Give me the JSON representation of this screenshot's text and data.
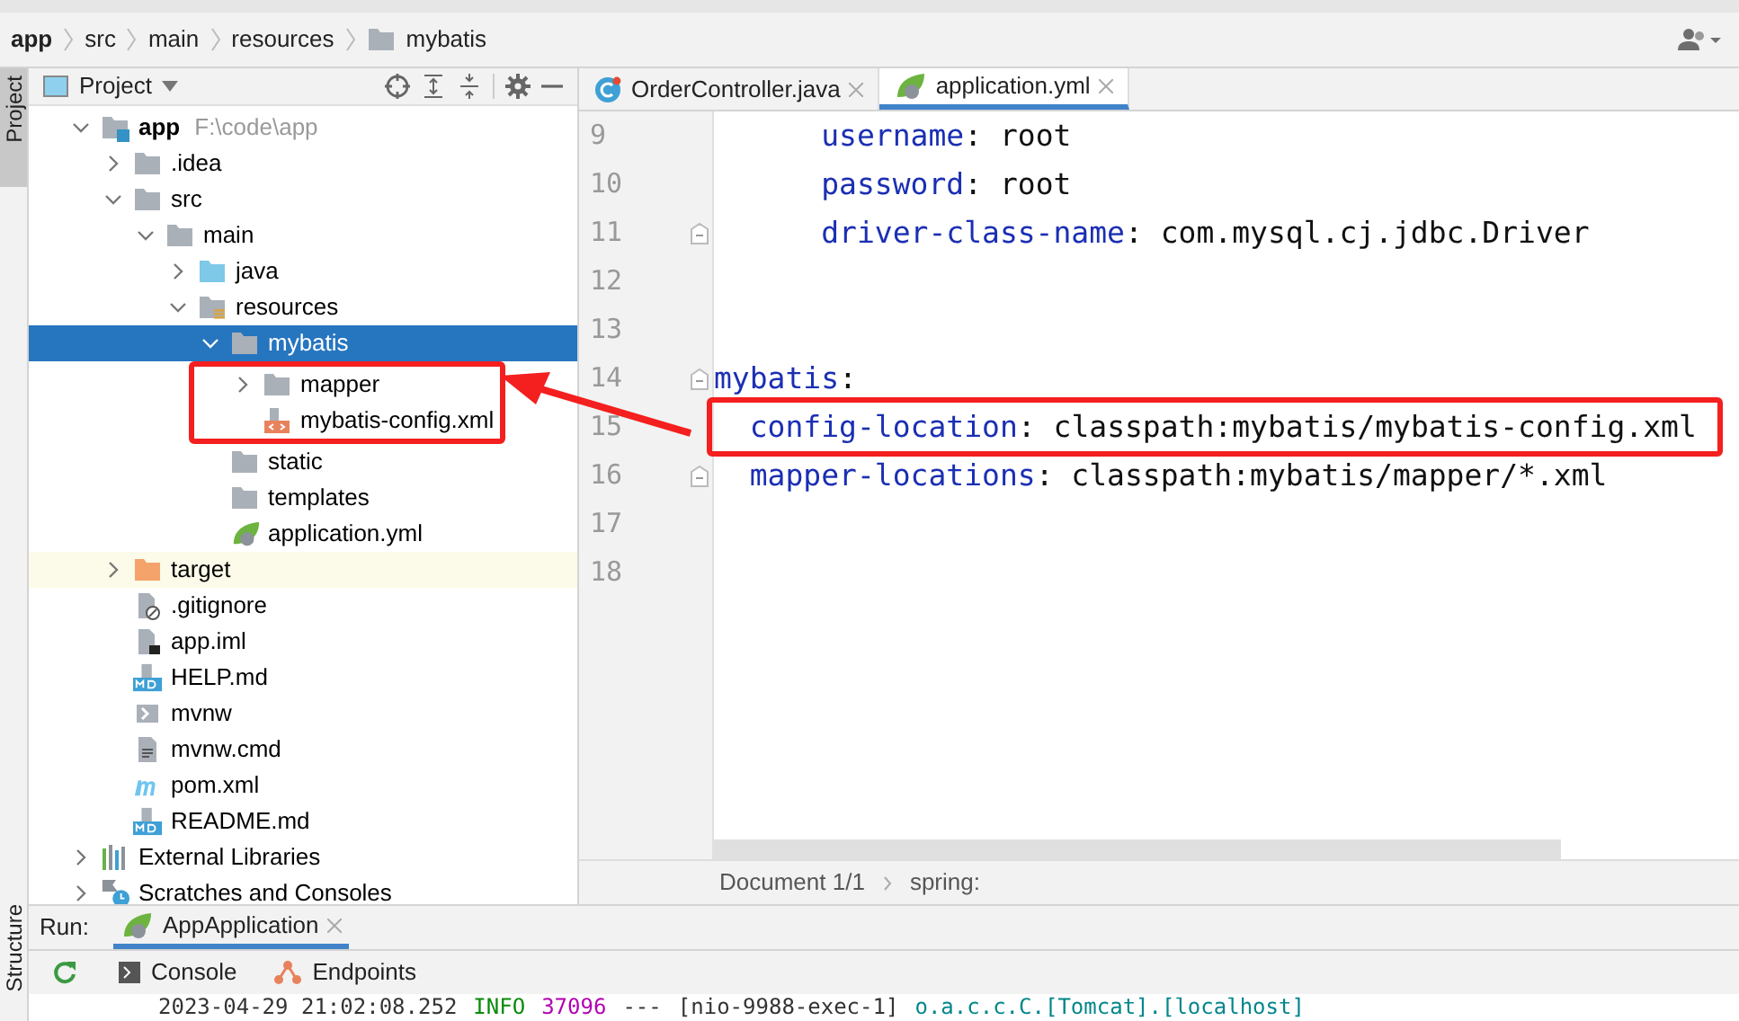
{
  "breadcrumb": [
    {
      "label": "app",
      "kind": "module"
    },
    {
      "label": "src",
      "kind": "plain"
    },
    {
      "label": "main",
      "kind": "plain"
    },
    {
      "label": "resources",
      "kind": "plain"
    },
    {
      "label": "mybatis",
      "kind": "folder"
    }
  ],
  "left_strip": {
    "top_tab": "Project",
    "bottom_tab": "Structure"
  },
  "project_panel": {
    "title": "Project",
    "tree": [
      {
        "label": "app",
        "hint": "F:\\code\\app",
        "kind": "module",
        "expanded": true,
        "selected": false,
        "highlighted": false,
        "children": [
          {
            "label": ".idea",
            "kind": "folder",
            "expanded": false,
            "selected": false,
            "highlighted": false
          },
          {
            "label": "src",
            "kind": "folder",
            "expanded": true,
            "selected": false,
            "highlighted": false,
            "children": [
              {
                "label": "main",
                "kind": "folder",
                "expanded": true,
                "selected": false,
                "highlighted": false,
                "children": [
                  {
                    "label": "java",
                    "kind": "source-folder",
                    "expanded": false,
                    "selected": false,
                    "highlighted": false
                  },
                  {
                    "label": "resources",
                    "kind": "resources-folder",
                    "expanded": true,
                    "selected": false,
                    "highlighted": false,
                    "children": [
                      {
                        "label": "mybatis",
                        "kind": "folder",
                        "expanded": true,
                        "selected": true,
                        "highlighted": false,
                        "children": [
                          {
                            "label": "mapper",
                            "kind": "folder",
                            "expanded": false,
                            "selected": false,
                            "highlighted": true
                          },
                          {
                            "label": "mybatis-config.xml",
                            "kind": "xml",
                            "selected": false,
                            "highlighted": true
                          }
                        ]
                      },
                      {
                        "label": "static",
                        "kind": "folder",
                        "selected": false,
                        "highlighted": false
                      },
                      {
                        "label": "templates",
                        "kind": "folder",
                        "selected": false,
                        "highlighted": false
                      },
                      {
                        "label": "application.yml",
                        "kind": "spring",
                        "selected": false,
                        "highlighted": false
                      }
                    ]
                  }
                ]
              }
            ]
          },
          {
            "label": "target",
            "kind": "excluded-folder",
            "expanded": false,
            "selected": false,
            "highlighted": false
          },
          {
            "label": ".gitignore",
            "kind": "ignore",
            "selected": false,
            "highlighted": false
          },
          {
            "label": "app.iml",
            "kind": "iml",
            "selected": false,
            "highlighted": false
          },
          {
            "label": "HELP.md",
            "kind": "markdown",
            "selected": false,
            "highlighted": false
          },
          {
            "label": "mvnw",
            "kind": "script",
            "selected": false,
            "highlighted": false
          },
          {
            "label": "mvnw.cmd",
            "kind": "text",
            "selected": false,
            "highlighted": false
          },
          {
            "label": "pom.xml",
            "kind": "maven",
            "selected": false,
            "highlighted": false
          },
          {
            "label": "README.md",
            "kind": "markdown",
            "selected": false,
            "highlighted": false
          }
        ]
      },
      {
        "label": "External Libraries",
        "kind": "libraries",
        "expanded": false,
        "selected": false,
        "highlighted": false
      },
      {
        "label": "Scratches and Consoles",
        "kind": "scratches",
        "expanded": false,
        "selected": false,
        "highlighted": false
      }
    ]
  },
  "editor": {
    "tabs": [
      {
        "label": "OrderController.java",
        "kind": "java",
        "selected": false
      },
      {
        "label": "application.yml",
        "kind": "spring",
        "selected": true
      }
    ],
    "lines": [
      {
        "number": "9",
        "key": "      username",
        "sep": ":",
        "value": " root",
        "fold": false,
        "highlighted": false
      },
      {
        "number": "10",
        "key": "      password",
        "sep": ":",
        "value": " root",
        "fold": false,
        "highlighted": false
      },
      {
        "number": "11",
        "key": "      driver-class-name",
        "sep": ":",
        "value": " com.mysql.cj.jdbc.Driver",
        "fold": true,
        "highlighted": false
      },
      {
        "number": "12",
        "fold": false,
        "highlighted": false
      },
      {
        "number": "13",
        "fold": false,
        "highlighted": false
      },
      {
        "number": "14",
        "key": "mybatis",
        "sep": ":",
        "fold": true,
        "highlighted": false
      },
      {
        "number": "15",
        "key": "  config-location",
        "sep": ":",
        "value": " classpath:mybatis/mybatis-config.xml",
        "fold": false,
        "highlighted": true
      },
      {
        "number": "16",
        "key": "  mapper-locations",
        "sep": ":",
        "value": " classpath:mybatis/mapper/*.xml",
        "fold": true,
        "highlighted": false
      },
      {
        "number": "17",
        "fold": false,
        "highlighted": false
      },
      {
        "number": "18",
        "fold": false,
        "highlighted": false
      }
    ],
    "status": [
      "Document 1/1",
      "spring:"
    ]
  },
  "run_panel": {
    "label": "Run:",
    "tab": "AppApplication",
    "toolbar": [
      {
        "label": "Console",
        "kind": "console"
      },
      {
        "label": "Endpoints",
        "kind": "endpoints"
      }
    ],
    "console_line": [
      {
        "text": "2023-04-29 21:02:08.252",
        "color": "#333333"
      },
      {
        "text": "INFO",
        "color": "#0a8a0a"
      },
      {
        "text": "37096",
        "color": "#b200b2"
      },
      {
        "text": "---",
        "color": "#333333"
      },
      {
        "text": "[nio-9988-exec-1]",
        "color": "#333333"
      },
      {
        "text": "o.a.c.c.C.[Tomcat].[localhost]",
        "color": "#00868b"
      }
    ]
  }
}
